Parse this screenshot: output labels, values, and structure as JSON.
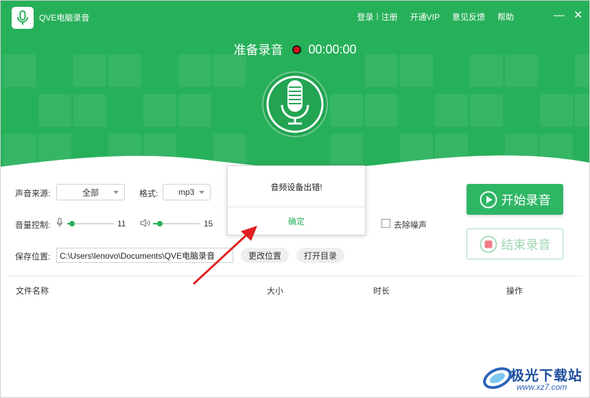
{
  "app": {
    "title": "QVE电脑录音"
  },
  "topnav": {
    "login": "登录",
    "separator": "|",
    "register": "注册",
    "vip": "开通VIP",
    "feedback": "意见反馈",
    "help": "帮助"
  },
  "window_controls": {
    "minimize": "—",
    "close": "✕"
  },
  "status": {
    "text": "准备录音",
    "timer": "00:00:00"
  },
  "source": {
    "label": "声音来源:",
    "value": "全部"
  },
  "format": {
    "label": "格式:",
    "value": "mp3"
  },
  "volume": {
    "label": "音量控制:",
    "mic_value": "11",
    "speaker_value": "15",
    "mic_level": 0.11,
    "speaker_level": 0.15
  },
  "noise": {
    "label": "去除噪声",
    "checked": false
  },
  "save": {
    "label": "保存位置:",
    "path": "C:\\Users\\lenovo\\Documents\\QVE电脑录音",
    "change_button": "更改位置",
    "open_button": "打开目录"
  },
  "actions": {
    "start": "开始录音",
    "stop": "结束录音"
  },
  "table": {
    "columns": [
      "文件名称",
      "大小",
      "时长",
      "操作"
    ]
  },
  "dialog": {
    "message": "音频设备出错!",
    "ok": "确定"
  },
  "watermark": {
    "title": "极光下载站",
    "url": "www.xz7.com"
  },
  "colors": {
    "brand": "#27b05a",
    "record_dot": "#d4141a",
    "stop_text": "#9fd6b4"
  }
}
